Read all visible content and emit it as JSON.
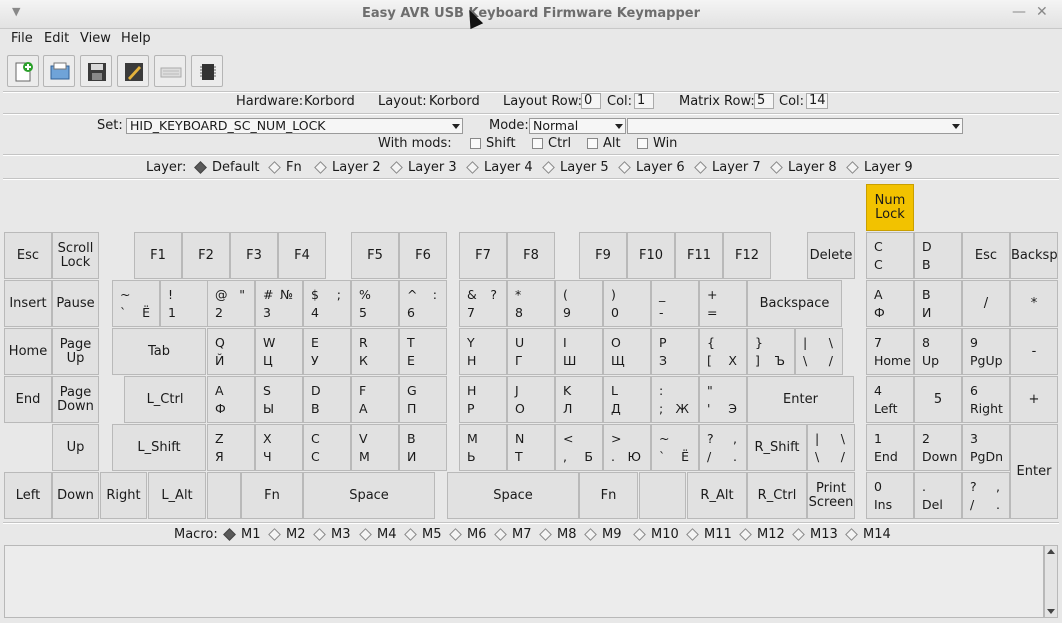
{
  "window": {
    "title": "Easy AVR USB Keyboard Firmware Keymapper"
  },
  "menu": [
    "File",
    "Edit",
    "View",
    "Help"
  ],
  "toolbar": [
    "new-file-icon",
    "open-file-icon",
    "save-icon",
    "edit-icon",
    "keyboard-icon",
    "firmware-chip-icon"
  ],
  "info": {
    "hardware_label": "Hardware:",
    "hardware": "Korbord",
    "layout_label": "Layout:",
    "layout": "Korbord",
    "layout_row_label": "Layout Row:",
    "layout_row": "0",
    "col_label": "Col:",
    "layout_col": "1",
    "matrix_row_label": "Matrix Row:",
    "matrix_row": "5",
    "matrix_col_label": "Col:",
    "matrix_col": "14"
  },
  "set": {
    "label": "Set:",
    "value": "HID_KEYBOARD_SC_NUM_LOCK",
    "mode_label": "Mode:",
    "mode": "Normal",
    "extra": "",
    "mods_label": "With mods:",
    "mods": [
      "Shift",
      "Ctrl",
      "Alt",
      "Win"
    ]
  },
  "layer": {
    "label": "Layer:",
    "items": [
      "Default",
      "Fn",
      "Layer 2",
      "Layer 3",
      "Layer 4",
      "Layer 5",
      "Layer 6",
      "Layer 7",
      "Layer 8",
      "Layer 9"
    ],
    "selected": 0
  },
  "keys": [
    [
      "Num\nLock",
      "yellow"
    ],
    [
      "Esc"
    ],
    [
      "Scroll\nLock"
    ],
    [
      "F1"
    ],
    [
      "F2"
    ],
    [
      "F3"
    ],
    [
      "F4"
    ],
    [
      "F5"
    ],
    [
      "F6"
    ],
    [
      "F7"
    ],
    [
      "F8"
    ],
    [
      "F9"
    ],
    [
      "F10"
    ],
    [
      "F11"
    ],
    [
      "F12"
    ],
    [
      "Delete"
    ],
    [
      "",
      "C",
      "",
      "C"
    ],
    [
      "",
      "D",
      "",
      "В"
    ],
    [
      "Esc"
    ],
    [
      "Backsp"
    ],
    [
      "Insert"
    ],
    [
      "Pause"
    ],
    [
      "",
      "~",
      "",
      "`",
      "Ё"
    ],
    [
      "",
      "!",
      "",
      "1"
    ],
    [
      "",
      "@",
      "\"",
      "2"
    ],
    [
      "",
      "#",
      "№",
      "3"
    ],
    [
      "",
      "$",
      ";",
      "4"
    ],
    [
      "",
      "%",
      "",
      "5"
    ],
    [
      "",
      "^",
      ":",
      "6"
    ],
    [
      "",
      "&",
      "?",
      "7"
    ],
    [
      "",
      "*",
      "",
      "8"
    ],
    [
      "",
      "(",
      "",
      "9"
    ],
    [
      "",
      ")",
      "",
      "0"
    ],
    [
      "",
      "_",
      "",
      "-"
    ],
    [
      "",
      "+",
      "",
      "="
    ],
    [
      "Backspace"
    ],
    [
      "",
      "A",
      "",
      "Ф"
    ],
    [
      "",
      "B",
      "",
      "И"
    ],
    [
      "/"
    ],
    [
      "*"
    ],
    [
      "Home"
    ],
    [
      "Page\nUp"
    ],
    [
      "Tab"
    ],
    [
      "",
      "Q",
      "",
      "Й"
    ],
    [
      "",
      "W",
      "",
      "Ц"
    ],
    [
      "",
      "E",
      "",
      "У"
    ],
    [
      "",
      "R",
      "",
      "К"
    ],
    [
      "",
      "T",
      "",
      "Е"
    ],
    [
      "",
      "Y",
      "",
      "Н"
    ],
    [
      "",
      "U",
      "",
      "Г"
    ],
    [
      "",
      "I",
      "",
      "Ш"
    ],
    [
      "",
      "O",
      "",
      "Щ"
    ],
    [
      "",
      "P",
      "",
      "З"
    ],
    [
      "",
      "{",
      "",
      "[",
      "Х"
    ],
    [
      "",
      "}",
      "",
      "]",
      "Ъ"
    ],
    [
      "",
      "|",
      "\\",
      "\\",
      "/"
    ],
    [
      "",
      "7",
      "",
      "Home"
    ],
    [
      "",
      "8",
      "",
      "Up"
    ],
    [
      "",
      "9",
      "",
      "PgUp"
    ],
    [
      "-"
    ],
    [
      "End"
    ],
    [
      "Page\nDown"
    ],
    [
      "L_Ctrl"
    ],
    [
      "",
      "A",
      "",
      "Ф"
    ],
    [
      "",
      "S",
      "",
      "Ы"
    ],
    [
      "",
      "D",
      "",
      "В"
    ],
    [
      "",
      "F",
      "",
      "А"
    ],
    [
      "",
      "G",
      "",
      "П"
    ],
    [
      "",
      "H",
      "",
      "Р"
    ],
    [
      "",
      "J",
      "",
      "О"
    ],
    [
      "",
      "K",
      "",
      "Л"
    ],
    [
      "",
      "L",
      "",
      "Д"
    ],
    [
      "",
      ":",
      "",
      ";",
      "Ж"
    ],
    [
      "",
      "\"",
      "",
      "'",
      "Э"
    ],
    [
      "Enter"
    ],
    [
      "",
      "4",
      "",
      "Left"
    ],
    [
      "5"
    ],
    [
      "",
      "6",
      "",
      "Right"
    ],
    [
      "+"
    ],
    [
      "Up"
    ],
    [
      "L_Shift"
    ],
    [
      "",
      "Z",
      "",
      "Я"
    ],
    [
      "",
      "X",
      "",
      "Ч"
    ],
    [
      "",
      "C",
      "",
      "С"
    ],
    [
      "",
      "V",
      "",
      "М"
    ],
    [
      "",
      "B",
      "",
      "И"
    ],
    [
      "",
      "M",
      "",
      "Ь"
    ],
    [
      "",
      "N",
      "",
      "Т"
    ],
    [
      "",
      "<",
      "",
      ",",
      "Б"
    ],
    [
      "",
      ">",
      "",
      ".",
      "Ю"
    ],
    [
      "",
      "~",
      "",
      "`",
      "Ё"
    ],
    [
      "",
      "?",
      ",",
      "/",
      "."
    ],
    [
      "R_Shift"
    ],
    [
      "",
      "|",
      "\\",
      "\\",
      "/"
    ],
    [
      "",
      "1",
      "",
      "End"
    ],
    [
      "",
      "2",
      "",
      "Down"
    ],
    [
      "",
      "3",
      "",
      "PgDn"
    ],
    [
      "Enter"
    ],
    [
      "Left"
    ],
    [
      "Down"
    ],
    [
      "Right"
    ],
    [
      "L_Alt"
    ],
    [
      ""
    ],
    [
      "Fn"
    ],
    [
      "Space"
    ],
    [
      "Space"
    ],
    [
      "Fn"
    ],
    [
      ""
    ],
    [
      "R_Alt"
    ],
    [
      "R_Ctrl"
    ],
    [
      "Print\nScreen"
    ],
    [
      "",
      "0",
      "",
      "Ins"
    ],
    [
      "",
      ".",
      "",
      "Del"
    ],
    [
      "",
      "?",
      ",",
      "/",
      "."
    ]
  ],
  "macro": {
    "label": "Macro:",
    "items": [
      "M1",
      "M2",
      "M3",
      "M4",
      "M5",
      "M6",
      "M7",
      "M8",
      "M9",
      "M10",
      "M11",
      "M12",
      "M13",
      "M14"
    ],
    "selected": 0
  },
  "colors": {
    "highlight": "#f2c200",
    "key": "#e1e1e1"
  }
}
